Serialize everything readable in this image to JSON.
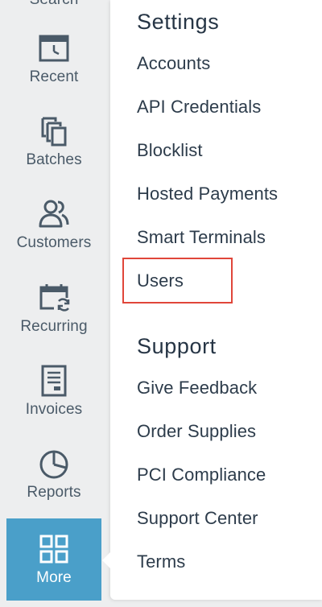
{
  "nav": {
    "search_label": "Search",
    "items": [
      {
        "label": "Recent",
        "icon": "calendar-clock-icon"
      },
      {
        "label": "Batches",
        "icon": "stacked-pages-icon"
      },
      {
        "label": "Customers",
        "icon": "users-icon"
      },
      {
        "label": "Recurring",
        "icon": "calendar-refresh-icon"
      },
      {
        "label": "Invoices",
        "icon": "document-icon"
      },
      {
        "label": "Reports",
        "icon": "pie-chart-icon"
      },
      {
        "label": "More",
        "icon": "grid-icon",
        "active": true
      }
    ]
  },
  "settings": {
    "title": "Settings",
    "links": [
      "Accounts",
      "API Credentials",
      "Blocklist",
      "Hosted Payments",
      "Smart Terminals",
      "Users"
    ]
  },
  "support": {
    "title": "Support",
    "links": [
      "Give Feedback",
      "Order Supplies",
      "PCI Compliance",
      "Support Center",
      "Terms"
    ]
  },
  "colors": {
    "accent": "#4a9fc9",
    "highlight": "#e0463a",
    "text": "#2d3c4b",
    "icon": "#4a5a68"
  }
}
